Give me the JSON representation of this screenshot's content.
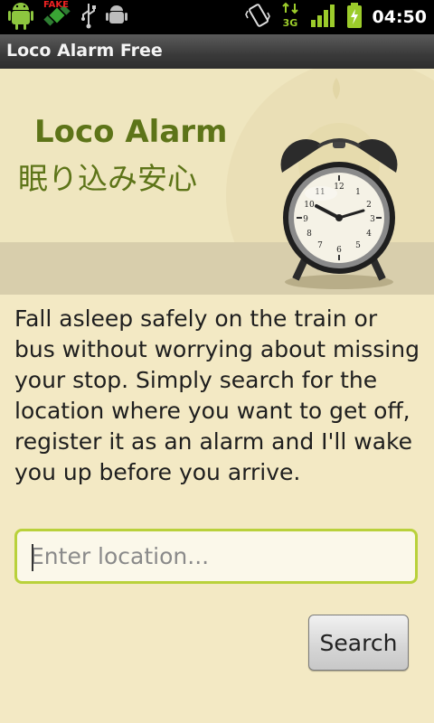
{
  "status_bar": {
    "time": "04:50",
    "fake_label": "FAKE",
    "left_icons": [
      "android-icon",
      "fake-gps-icon",
      "usb-icon",
      "debug-icon"
    ],
    "right_icons": [
      "vibrate-icon",
      "3g-data-icon",
      "signal-icon",
      "battery-charging-icon"
    ],
    "network_type": "3G"
  },
  "app": {
    "title": "Loco Alarm Free"
  },
  "banner": {
    "title": "Loco Alarm",
    "subtitle": "眠り込み安心"
  },
  "description": "Fall asleep safely on the train or bus without worrying about missing your stop. Simply search for the location where you want to get off, register it as an alarm and I'll wake you up before you arrive.",
  "search": {
    "placeholder": "Enter location...",
    "value": "",
    "button_label": "Search"
  },
  "colors": {
    "background": "#f3e9c4",
    "banner_text": "#5d7418",
    "input_border": "#b9d13b"
  }
}
